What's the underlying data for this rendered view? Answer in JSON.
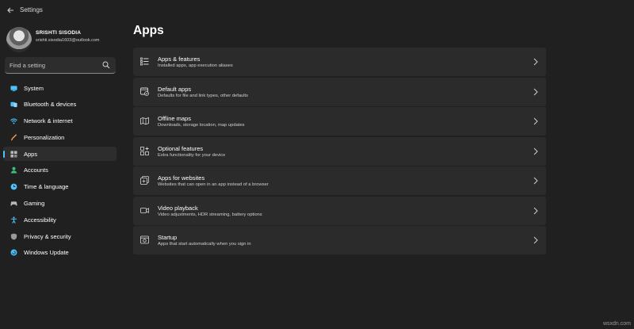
{
  "window": {
    "title": "Settings"
  },
  "user": {
    "name": "SRISHTI SISODIA",
    "email": "srishti.sisodia1603@outlook.com"
  },
  "search": {
    "placeholder": "Find a setting"
  },
  "sidebar": {
    "items": [
      {
        "label": "System",
        "icon": "system-icon",
        "color": "#4cc2ff"
      },
      {
        "label": "Bluetooth & devices",
        "icon": "bluetooth-devices-icon",
        "color": "#4cc2ff"
      },
      {
        "label": "Network & internet",
        "icon": "network-icon",
        "color": "#4cc2ff"
      },
      {
        "label": "Personalization",
        "icon": "personalization-icon",
        "color": "#f0a050"
      },
      {
        "label": "Apps",
        "icon": "apps-icon",
        "color": "#b0b0b0",
        "active": true
      },
      {
        "label": "Accounts",
        "icon": "accounts-icon",
        "color": "#3ec07a"
      },
      {
        "label": "Time & language",
        "icon": "time-language-icon",
        "color": "#4cc2ff"
      },
      {
        "label": "Gaming",
        "icon": "gaming-icon",
        "color": "#b0b0b0"
      },
      {
        "label": "Accessibility",
        "icon": "accessibility-icon",
        "color": "#4cc2ff"
      },
      {
        "label": "Privacy & security",
        "icon": "privacy-shield-icon",
        "color": "#b0b0b0"
      },
      {
        "label": "Windows Update",
        "icon": "windows-update-icon",
        "color": "#4cc2ff"
      }
    ]
  },
  "main": {
    "title": "Apps",
    "cards": [
      {
        "title": "Apps & features",
        "description": "Installed apps, app execution aliases",
        "icon": "apps-features-icon"
      },
      {
        "title": "Default apps",
        "description": "Defaults for file and link types, other defaults",
        "icon": "default-apps-icon"
      },
      {
        "title": "Offline maps",
        "description": "Downloads, storage location, map updates",
        "icon": "offline-maps-icon"
      },
      {
        "title": "Optional features",
        "description": "Extra functionality for your device",
        "icon": "optional-features-icon"
      },
      {
        "title": "Apps for websites",
        "description": "Websites that can open in an app instead of a browser",
        "icon": "apps-websites-icon"
      },
      {
        "title": "Video playback",
        "description": "Video adjustments, HDR streaming, battery options",
        "icon": "video-playback-icon"
      },
      {
        "title": "Startup",
        "description": "Apps that start automatically when you sign in",
        "icon": "startup-icon"
      }
    ]
  },
  "watermark": "wsxdn.com",
  "colors": {
    "background": "#202020",
    "card": "#2b2b2b",
    "accent": "#4cc2ff"
  }
}
